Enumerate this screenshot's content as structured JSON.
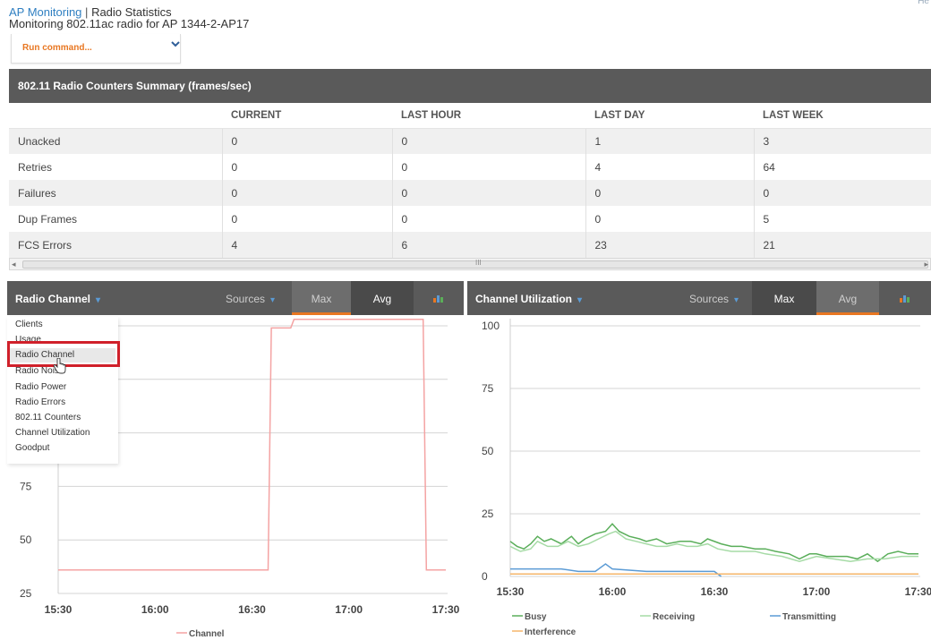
{
  "header": {
    "breadcrumb_link": "AP Monitoring",
    "breadcrumb_sep": "|",
    "breadcrumb_current": "Radio Statistics",
    "subtitle": "Monitoring 802.11ac radio for AP 1344-2-AP17",
    "run_command_label": "Run command...",
    "corner_text": "He"
  },
  "summary_table": {
    "title": "802.11 Radio Counters Summary (frames/sec)",
    "columns": [
      "",
      "CURRENT",
      "LAST HOUR",
      "LAST DAY",
      "LAST WEEK"
    ],
    "rows": [
      {
        "label": "Unacked",
        "values": [
          "0",
          "0",
          "1",
          "3"
        ]
      },
      {
        "label": "Retries",
        "values": [
          "0",
          "0",
          "4",
          "64"
        ]
      },
      {
        "label": "Failures",
        "values": [
          "0",
          "0",
          "0",
          "0"
        ]
      },
      {
        "label": "Dup Frames",
        "values": [
          "0",
          "0",
          "0",
          "5"
        ]
      },
      {
        "label": "FCS Errors",
        "values": [
          "4",
          "6",
          "23",
          "21"
        ]
      }
    ],
    "scroll_mark": "III"
  },
  "left_chart": {
    "title": "Radio Channel",
    "sources_label": "Sources",
    "tab_max": "Max",
    "tab_avg": "Avg",
    "active_tab": "Max",
    "dropdown_items": [
      "Clients",
      "Usage",
      "Radio Channel",
      "Radio Noise",
      "Radio Power",
      "Radio Errors",
      "802.11 Counters",
      "Channel Utilization",
      "Goodput"
    ],
    "dropdown_selected": "Radio Channel"
  },
  "right_chart": {
    "title": "Channel Utilization",
    "sources_label": "Sources",
    "tab_max": "Max",
    "tab_avg": "Avg",
    "active_tab": "Avg"
  },
  "colors": {
    "accent": "#e87722",
    "header_bar": "#5a5a5a",
    "highlight_box": "#d0202a",
    "link": "#2f7fc1"
  },
  "chart_data": [
    {
      "type": "line",
      "x": [
        "15:30",
        "16:00",
        "16:30",
        "17:00",
        "17:30"
      ],
      "ylim": [
        25,
        150
      ],
      "yticks": [
        25,
        50,
        75,
        100,
        125,
        150
      ],
      "series": [
        {
          "name": "Channel",
          "color": "#f4a3a3",
          "points": [
            [
              "15:30",
              36
            ],
            [
              "16:35",
              36
            ],
            [
              "16:36",
              149
            ],
            [
              "16:42",
              149
            ],
            [
              "16:43",
              153
            ],
            [
              "17:23",
              153
            ],
            [
              "17:24",
              36
            ],
            [
              "17:30",
              36
            ]
          ]
        }
      ]
    },
    {
      "type": "line",
      "x": [
        "15:30",
        "16:00",
        "16:30",
        "17:00",
        "17:30"
      ],
      "ylim": [
        0,
        100
      ],
      "yticks": [
        0,
        25,
        50,
        75,
        100
      ],
      "series": [
        {
          "name": "Busy",
          "color": "#5aae5a",
          "points": [
            [
              "15:30",
              14
            ],
            [
              "15:32",
              12
            ],
            [
              "15:34",
              11
            ],
            [
              "15:36",
              13
            ],
            [
              "15:38",
              16
            ],
            [
              "15:40",
              14
            ],
            [
              "15:42",
              15
            ],
            [
              "15:45",
              13
            ],
            [
              "15:48",
              16
            ],
            [
              "15:50",
              13
            ],
            [
              "15:52",
              15
            ],
            [
              "15:55",
              17
            ],
            [
              "15:58",
              18
            ],
            [
              "16:00",
              21
            ],
            [
              "16:02",
              18
            ],
            [
              "16:05",
              16
            ],
            [
              "16:08",
              15
            ],
            [
              "16:10",
              14
            ],
            [
              "16:13",
              15
            ],
            [
              "16:16",
              13
            ],
            [
              "16:20",
              14
            ],
            [
              "16:23",
              14
            ],
            [
              "16:26",
              13
            ],
            [
              "16:28",
              15
            ],
            [
              "16:32",
              13
            ],
            [
              "16:35",
              12
            ],
            [
              "16:38",
              12
            ],
            [
              "16:42",
              11
            ],
            [
              "16:45",
              11
            ],
            [
              "16:48",
              10
            ],
            [
              "16:52",
              9
            ],
            [
              "16:55",
              7
            ],
            [
              "16:58",
              9
            ],
            [
              "17:00",
              9
            ],
            [
              "17:03",
              8
            ],
            [
              "17:06",
              8
            ],
            [
              "17:09",
              8
            ],
            [
              "17:12",
              7
            ],
            [
              "17:15",
              9
            ],
            [
              "17:18",
              6
            ],
            [
              "17:21",
              9
            ],
            [
              "17:24",
              10
            ],
            [
              "17:27",
              9
            ],
            [
              "17:30",
              9
            ]
          ]
        },
        {
          "name": "Receiving",
          "color": "#a6dba6",
          "points": [
            [
              "15:30",
              12
            ],
            [
              "15:33",
              10
            ],
            [
              "15:36",
              11
            ],
            [
              "15:38",
              14
            ],
            [
              "15:41",
              12
            ],
            [
              "15:44",
              12
            ],
            [
              "15:47",
              14
            ],
            [
              "15:50",
              12
            ],
            [
              "15:53",
              13
            ],
            [
              "15:56",
              15
            ],
            [
              "15:59",
              17
            ],
            [
              "16:01",
              18
            ],
            [
              "16:04",
              15
            ],
            [
              "16:07",
              14
            ],
            [
              "16:10",
              13
            ],
            [
              "16:13",
              12
            ],
            [
              "16:16",
              12
            ],
            [
              "16:19",
              13
            ],
            [
              "16:22",
              12
            ],
            [
              "16:25",
              12
            ],
            [
              "16:28",
              13
            ],
            [
              "16:31",
              11
            ],
            [
              "16:35",
              10
            ],
            [
              "16:38",
              10
            ],
            [
              "16:42",
              10
            ],
            [
              "16:45",
              9
            ],
            [
              "16:50",
              8
            ],
            [
              "16:55",
              6
            ],
            [
              "17:00",
              8
            ],
            [
              "17:05",
              7
            ],
            [
              "17:10",
              6
            ],
            [
              "17:15",
              7
            ],
            [
              "17:20",
              7
            ],
            [
              "17:25",
              8
            ],
            [
              "17:30",
              8
            ]
          ]
        },
        {
          "name": "Transmitting",
          "color": "#5b9bd5",
          "points": [
            [
              "15:30",
              3
            ],
            [
              "15:45",
              3
            ],
            [
              "15:50",
              2
            ],
            [
              "15:55",
              2
            ],
            [
              "15:58",
              5
            ],
            [
              "16:00",
              3
            ],
            [
              "16:10",
              2
            ],
            [
              "16:20",
              2
            ],
            [
              "16:30",
              2
            ],
            [
              "16:32",
              0
            ]
          ]
        },
        {
          "name": "Interference",
          "color": "#f5b56a",
          "points": [
            [
              "15:30",
              1
            ],
            [
              "16:30",
              1
            ],
            [
              "17:00",
              1
            ],
            [
              "17:30",
              1
            ]
          ]
        }
      ]
    }
  ]
}
